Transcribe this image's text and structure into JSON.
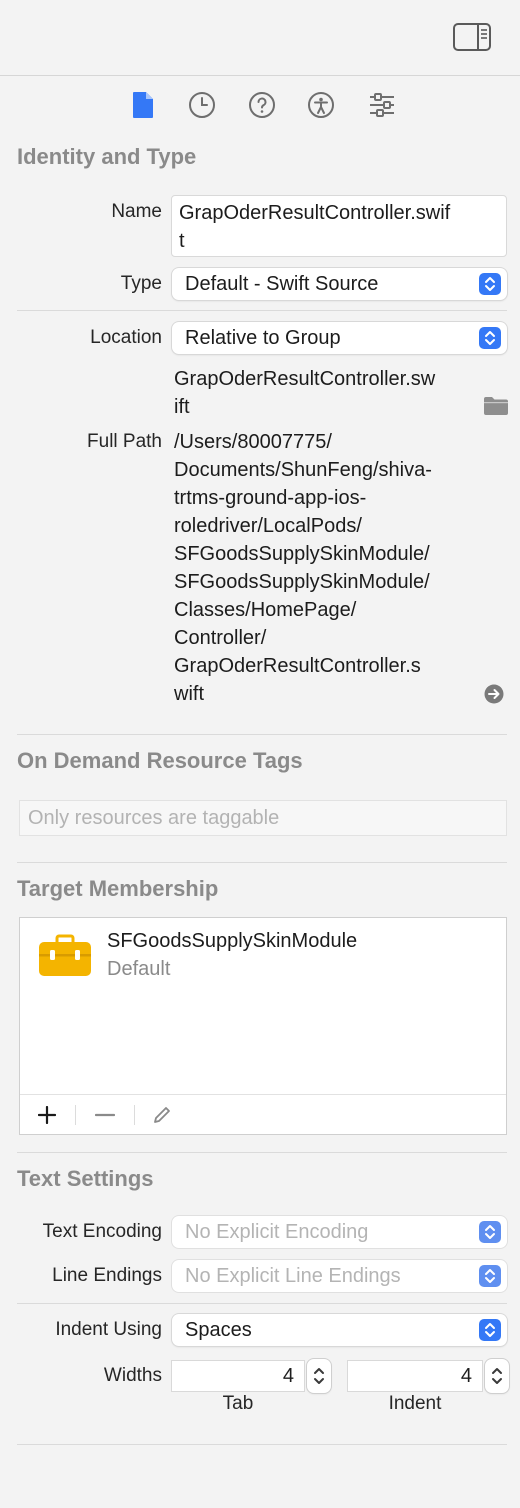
{
  "tabs": [
    {
      "name": "file-inspector",
      "icon": "document-icon",
      "active": true
    },
    {
      "name": "history-inspector",
      "icon": "clock-icon",
      "active": false
    },
    {
      "name": "quick-help",
      "icon": "question-icon",
      "active": false
    },
    {
      "name": "accessibility-inspector",
      "icon": "accessibility-icon",
      "active": false
    },
    {
      "name": "attributes-inspector",
      "icon": "sliders-icon",
      "active": false
    }
  ],
  "identity": {
    "title": "Identity and Type",
    "name_label": "Name",
    "name_value_line1": "GrapOderResultController.swif",
    "name_value_line2": "t",
    "type_label": "Type",
    "type_value": "Default - Swift Source",
    "location_label": "Location",
    "location_value": "Relative to Group",
    "filename_line1": "GrapOderResultController.sw",
    "filename_line2": "ift",
    "fullpath_label": "Full Path",
    "fullpath_lines": [
      "/Users/80007775/",
      "Documents/ShunFeng/shiva-",
      "trtms-ground-app-ios-",
      "roledriver/LocalPods/",
      "SFGoodsSupplySkinModule/",
      "SFGoodsSupplySkinModule/",
      "Classes/HomePage/",
      "Controller/",
      "GrapOderResultController.s",
      "wift"
    ]
  },
  "odr": {
    "title": "On Demand Resource Tags",
    "placeholder": "Only resources are taggable"
  },
  "membership": {
    "title": "Target Membership",
    "targets": [
      {
        "name": "SFGoodsSupplySkinModule",
        "subtitle": "Default",
        "icon": "toolbox-icon"
      }
    ],
    "add_label": "+",
    "remove_label": "−"
  },
  "text_settings": {
    "title": "Text Settings",
    "encoding_label": "Text Encoding",
    "encoding_value": "No Explicit Encoding",
    "line_endings_label": "Line Endings",
    "line_endings_value": "No Explicit Line Endings",
    "indent_label": "Indent Using",
    "indent_value": "Spaces",
    "widths_label": "Widths",
    "tab_value": "4",
    "tab_caption": "Tab",
    "indent_width_value": "4",
    "indent_caption": "Indent"
  },
  "colors": {
    "accent": "#3478f6",
    "folder": "#8e8e8e",
    "toolbox": "#f4b400"
  }
}
